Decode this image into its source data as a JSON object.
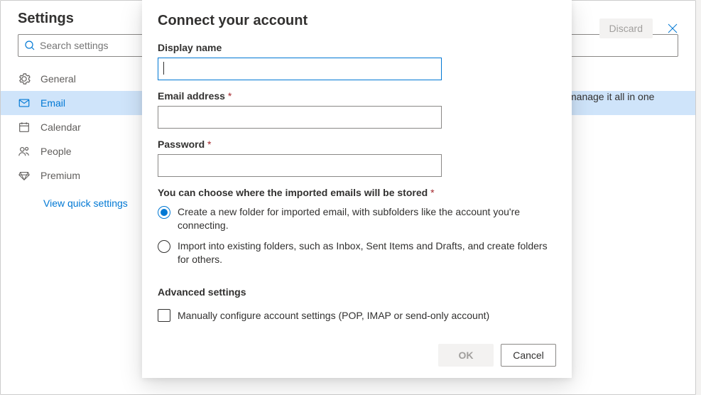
{
  "settings": {
    "title": "Settings",
    "search_placeholder": "Search settings",
    "nav": [
      {
        "label": "General"
      },
      {
        "label": "Email"
      },
      {
        "label": "Calendar"
      },
      {
        "label": "People"
      },
      {
        "label": "Premium"
      }
    ],
    "quick_settings": "View quick settings"
  },
  "topbar": {
    "discard": "Discard"
  },
  "background_hint": "manage it all in one",
  "modal": {
    "title": "Connect your account",
    "display_name_label": "Display name",
    "display_name_value": "",
    "email_label": "Email address",
    "email_value": "",
    "password_label": "Password",
    "password_value": "",
    "storage_heading": "You can choose where the imported emails will be stored",
    "radio_new_folder": "Create a new folder for imported email, with subfolders like the account you're connecting.",
    "radio_existing": "Import into existing folders, such as Inbox, Sent Items and Drafts, and create folders for others.",
    "advanced_heading": "Advanced settings",
    "manual_config_label": "Manually configure account settings (POP, IMAP or send-only account)",
    "ok_label": "OK",
    "cancel_label": "Cancel",
    "required_marker": "*"
  }
}
